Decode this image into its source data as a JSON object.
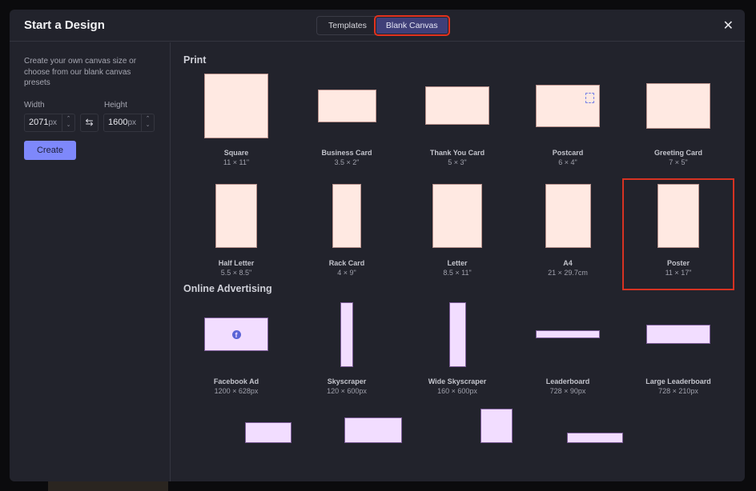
{
  "header": {
    "title": "Start a Design",
    "tabs": [
      {
        "label": "Templates"
      },
      {
        "label": "Blank Canvas",
        "active": true
      }
    ],
    "close": "✕"
  },
  "sidebar": {
    "description": "Create your own canvas size or choose from our blank canvas presets",
    "width_label": "Width",
    "height_label": "Height",
    "width_value": "2071",
    "height_value": "1600",
    "unit": "px",
    "create_label": "Create"
  },
  "sections": [
    {
      "title": "Print",
      "items": [
        {
          "name": "Square",
          "size": "11 × 11\""
        },
        {
          "name": "Business Card",
          "size": "3.5 × 2\""
        },
        {
          "name": "Thank You Card",
          "size": "5 × 3\""
        },
        {
          "name": "Postcard",
          "size": "6 × 4\""
        },
        {
          "name": "Greeting Card",
          "size": "7 × 5\""
        },
        {
          "name": "Half Letter",
          "size": "5.5 × 8.5\""
        },
        {
          "name": "Rack Card",
          "size": "4 × 9\""
        },
        {
          "name": "Letter",
          "size": "8.5 × 11\""
        },
        {
          "name": "A4",
          "size": "21 × 29.7cm"
        },
        {
          "name": "Poster",
          "size": "11 × 17\"",
          "highlighted": true
        }
      ]
    },
    {
      "title": "Online Advertising",
      "items": [
        {
          "name": "Facebook Ad",
          "size": "1200 × 628px"
        },
        {
          "name": "Skyscraper",
          "size": "120 × 600px"
        },
        {
          "name": "Wide Skyscraper",
          "size": "160 × 600px"
        },
        {
          "name": "Leaderboard",
          "size": "728 × 90px"
        },
        {
          "name": "Large Leaderboard",
          "size": "728 × 210px"
        }
      ]
    }
  ],
  "colors": {
    "accent": "#7e88fb",
    "highlight": "#d63222",
    "print_fill": "#ffe9e2",
    "ads_fill": "#f2ddff"
  }
}
